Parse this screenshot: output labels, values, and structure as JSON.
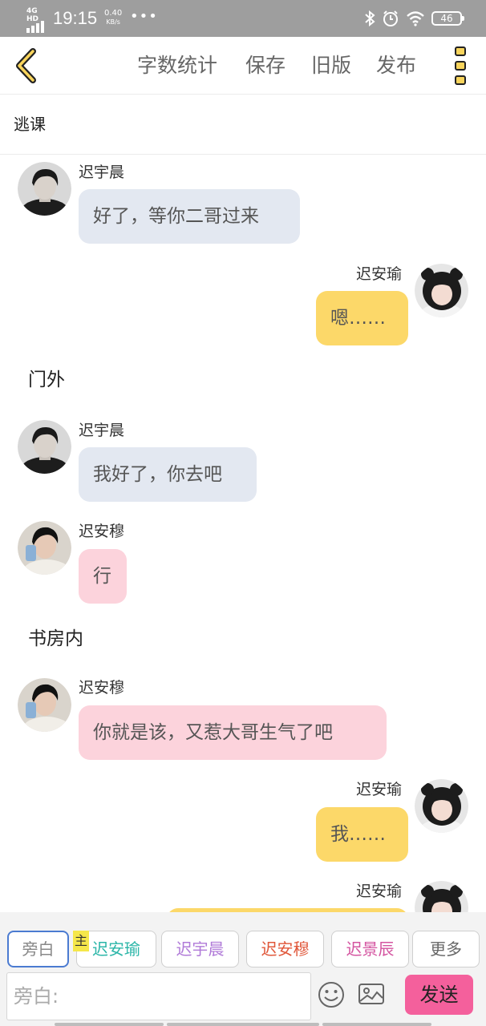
{
  "status_bar": {
    "network": "4G HD",
    "time": "19:15",
    "speed_value": "0.40",
    "speed_unit": "KB/s",
    "dots": "•••",
    "battery": "46"
  },
  "app_bar": {
    "menu": [
      "字数统计",
      "保存",
      "旧版",
      "发布"
    ]
  },
  "story": {
    "title": "逃课"
  },
  "messages": [
    {
      "type": "left",
      "name": "迟宇晨",
      "text": "好了，等你二哥过来",
      "bubble_color": "#e3e8f1",
      "avatar": "avatar-chen"
    },
    {
      "type": "right",
      "name": "迟安瑜",
      "text": "嗯……",
      "bubble_color": "#fcd869",
      "avatar": "avatar-yu"
    },
    {
      "type": "narration",
      "text": "门外"
    },
    {
      "type": "left",
      "name": "迟宇晨",
      "text": "我好了，你去吧",
      "bubble_color": "#e3e8f1",
      "avatar": "avatar-chen"
    },
    {
      "type": "left",
      "name": "迟安穆",
      "text": "行",
      "bubble_color": "#fcd3dc",
      "avatar": "avatar-mu"
    },
    {
      "type": "narration",
      "text": "书房内"
    },
    {
      "type": "left",
      "name": "迟安穆",
      "text": "你就是该，又惹大哥生气了吧",
      "bubble_color": "#fcd3dc",
      "avatar": "avatar-mu"
    },
    {
      "type": "right",
      "name": "迟安瑜",
      "text": "我……",
      "bubble_color": "#fcd869",
      "avatar": "avatar-yu"
    },
    {
      "type": "right",
      "name": "迟安瑜",
      "text": "",
      "bubble_color": "#fcd869",
      "avatar": "avatar-yu"
    }
  ],
  "character_bar": {
    "main_tag": "主",
    "chips": [
      {
        "label": "旁白",
        "color": "#888888",
        "active": true
      },
      {
        "label": "迟安瑜",
        "color": "#2bb6a8",
        "active": false
      },
      {
        "label": "迟宇晨",
        "color": "#b07ad8",
        "active": false
      },
      {
        "label": "迟安穆",
        "color": "#e0573a",
        "active": false
      },
      {
        "label": "迟景辰",
        "color": "#d454a0",
        "active": false
      },
      {
        "label": "更多",
        "color": "#666666",
        "active": false
      }
    ]
  },
  "input_bar": {
    "placeholder": "旁白:",
    "value": "",
    "send_label": "发送"
  }
}
